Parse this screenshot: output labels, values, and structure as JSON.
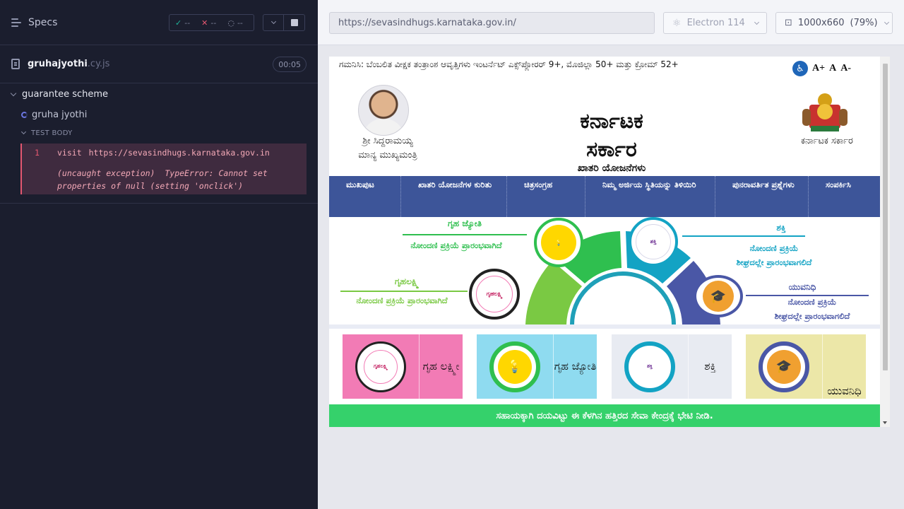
{
  "reporter": {
    "title": "Specs",
    "stats": {
      "passed": "--",
      "failed": "--",
      "pending": "--"
    },
    "file": {
      "name": "gruhajyothi",
      "ext": ".cy.js",
      "duration": "00:05"
    },
    "suite": "guarantee scheme",
    "test": "gruha jyothi",
    "section": "TEST BODY",
    "command": {
      "num": "1",
      "name": "visit",
      "arg": "https://sevasindhugs.karnataka.gov.in"
    },
    "error": {
      "label": "(uncaught exception)",
      "message": "TypeError: Cannot set properties of null (setting 'onclick')"
    }
  },
  "aut": {
    "url": "https://sevasindhugs.karnataka.gov.in/",
    "browser": "Electron 114",
    "viewport": "1000x660",
    "scale": "(79%)"
  },
  "site": {
    "notice": "ಗಮನಿಸಿ: ಬೆಂಬಲಿತ ವೀಕ್ಷಕ ತಂತ್ರಾಂಶ ಆವೃತ್ತಿಗಳು ಇಂಟರ್ನೆಟ್ ಎಕ್ಸ್‌ಪ್ಲೋರರ್ 9+, ಮೊಜಿಲ್ಲಾ 50+ ಮತ್ತು ಕ್ರೋಮ್ 52+",
    "font_buttons": {
      "increase": "A+",
      "normal": "A",
      "decrease": "A-"
    },
    "cm": {
      "name": "ಶ್ರೀ ಸಿದ್ದರಾಮಯ್ಯ",
      "role": "ಮಾನ್ಯ ಮುಖ್ಯಮಂತ್ರಿ"
    },
    "title_line1": "ಕರ್ನಾಟಕ",
    "title_line2": "ಸರ್ಕಾರ",
    "subtitle": "ಖಾತರಿ ಯೋಜನೆಗಳು",
    "emblem_label": "ಕರ್ನಾಟಕ ಸರ್ಕಾರ",
    "nav": [
      "ಮುಖಪುಟ",
      "ಖಾತರಿ ಯೋಜನೆಗಳ ಕುರಿತು",
      "ಚಿತ್ರಸಂಗ್ರಹ",
      "ನಿಮ್ಮ ಅರ್ಜಿಯ ಸ್ಥಿತಿಯನ್ನು ತಿಳಿಯಿರಿ",
      "ಪುನರಾವರ್ತಿತ ಪ್ರಶ್ನೆಗಳು",
      "ಸಂಪರ್ಕಿಸಿ"
    ],
    "hero": {
      "gruha_jyothi": {
        "title": "ಗೃಹ ಜ್ಯೋತಿ",
        "text": "ನೋಂದಣಿ ಪ್ರಕ್ರಿಯೆ ಪ್ರಾರಂಭವಾಗಿದೆ",
        "color": "#2fbf4f"
      },
      "gruhalakshmi": {
        "title": "ಗೃಹಲಕ್ಷ್ಮಿ",
        "text": "ನೋಂದಣಿ ಪ್ರಕ್ರಿಯೆ ಪ್ರಾರಂಭವಾಗಿದೆ",
        "color": "#7ac943"
      },
      "shakti": {
        "title": "ಶಕ್ತಿ",
        "text1": "ನೋಂದಣಿ ಪ್ರಕ್ರಿಯೆ",
        "text2": "ಶೀಘ್ರದಲ್ಲೇ ಪ್ರಾರಂಭವಾಗಲಿದೆ",
        "color": "#13a3c4"
      },
      "yuvanidhi": {
        "title": "ಯುವನಿಧಿ",
        "text1": "ನೋಂದಣಿ ಪ್ರಕ್ರಿಯೆ",
        "text2": "ಶೀಘ್ರದಲ್ಲೇ ಪ್ರಾರಂಭವಾಗಲಿದೆ",
        "color": "#4a57a6"
      }
    },
    "badges": {
      "gruhalakshmi": "ಗೃಹಲಕ್ಷ್ಮಿ",
      "gruha_jyothi": "ಗೃಹ ಜ್ಯೋತಿ",
      "shakti": "ಶಕ್ತಿ"
    },
    "cards": [
      {
        "label": "ಗೃಹ ಲಕ್ಷ್ಮೀ",
        "bg": "#f27bb5"
      },
      {
        "label": "ಗೃಹ ಜ್ಯೋತಿ",
        "bg": "#8fdbf0"
      },
      {
        "label": "ಶಕ್ತಿ",
        "bg": "#e8ebf2"
      },
      {
        "label": "ಯುವನಿಧಿ",
        "bg": "#ece7a8"
      }
    ],
    "footer": "ಸಹಾಯಕ್ಕಾಗಿ ದಯವಿಟ್ಟು ಈ ಕೆಳಗಿನ ಹತ್ತಿರದ ಸೇವಾ ಕೇಂದ್ರಕ್ಕೆ ಭೇಟಿ ನೀಡಿ."
  }
}
